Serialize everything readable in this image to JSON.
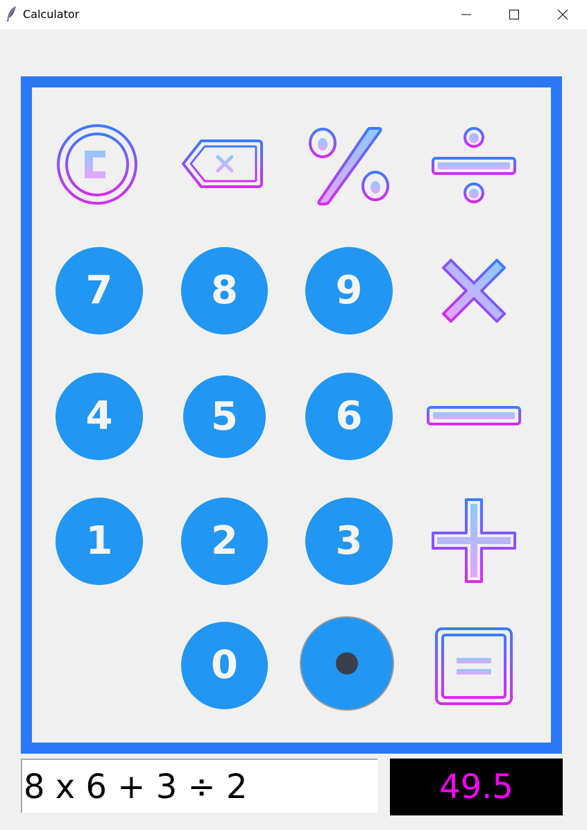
{
  "window": {
    "title": "Calculator",
    "icon": "feather-icon",
    "controls": [
      "minimize-icon",
      "maximize-icon",
      "close-icon"
    ]
  },
  "colors": {
    "frame": "#2b78f8",
    "number_key": "#2196f3",
    "number_text": "#f4f4f4",
    "operator_gradient_start": "#3d7bff",
    "operator_gradient_end": "#d62cf0",
    "operator_fill_start": "#8ec8ff",
    "operator_fill_end": "#e3a6ff",
    "result_text": "#ff00ff",
    "result_background": "#000000"
  },
  "keypad": {
    "operators": {
      "clear": "clear-icon",
      "backspace": "backspace-icon",
      "percent": "percent-icon",
      "divide": "divide-icon",
      "multiply": "multiply-icon",
      "subtract": "minus-icon",
      "add": "plus-icon",
      "equals": "equals-icon",
      "decimal": "decimal-point-icon"
    },
    "digits": {
      "d7": "7",
      "d8": "8",
      "d9": "9",
      "d4": "4",
      "d5": "5",
      "d6": "6",
      "d1": "1",
      "d2": "2",
      "d3": "3",
      "d0": "0"
    }
  },
  "display": {
    "expression": "8 x 6 + 3 ÷ 2",
    "result": "49.5"
  }
}
